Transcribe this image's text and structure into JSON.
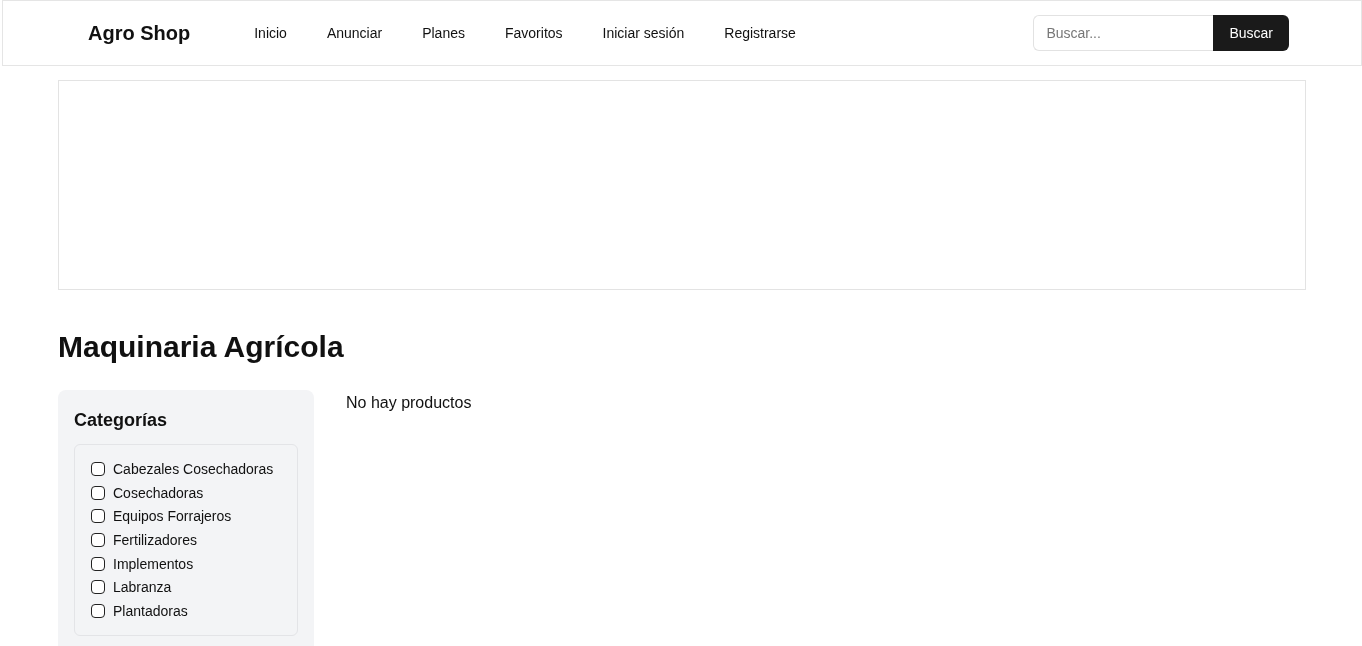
{
  "header": {
    "logo": "Agro Shop",
    "nav": [
      {
        "label": "Inicio"
      },
      {
        "label": "Anunciar"
      },
      {
        "label": "Planes"
      },
      {
        "label": "Favoritos"
      },
      {
        "label": "Iniciar sesión"
      },
      {
        "label": "Registrarse"
      }
    ],
    "search": {
      "placeholder": "Buscar...",
      "button": "Buscar"
    }
  },
  "page_title": "Maquinaria Agrícola",
  "sidebar": {
    "title": "Categorías",
    "categories": [
      {
        "label": "Cabezales Cosechadoras",
        "checked": false
      },
      {
        "label": "Cosechadoras",
        "checked": false
      },
      {
        "label": "Equipos Forrajeros",
        "checked": false
      },
      {
        "label": "Fertilizadores",
        "checked": false
      },
      {
        "label": "Implementos",
        "checked": false
      },
      {
        "label": "Labranza",
        "checked": false
      },
      {
        "label": "Plantadoras",
        "checked": false
      }
    ]
  },
  "results": {
    "empty_message": "No hay productos"
  }
}
